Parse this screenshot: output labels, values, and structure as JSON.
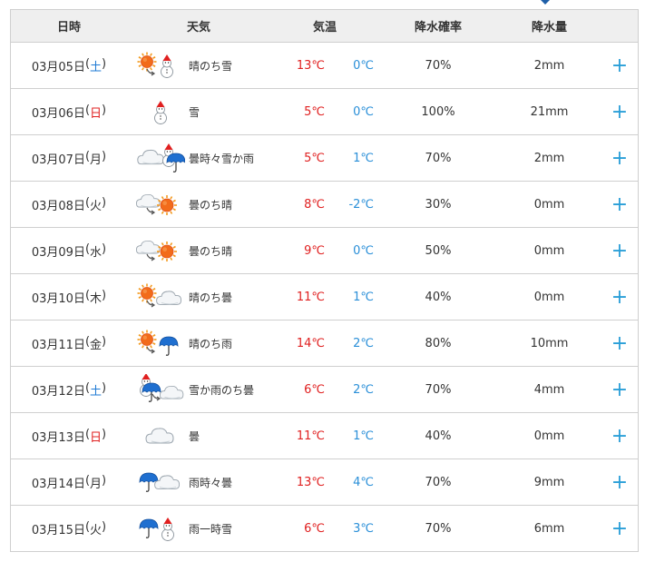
{
  "header": {
    "date": "日時",
    "weather": "天気",
    "temp": "気温",
    "precip_prob": "降水確率",
    "precip_amount": "降水量"
  },
  "colors": {
    "max_temp": "#e02020",
    "min_temp": "#2a8fd8",
    "saturday": "#1e7ad4",
    "sunday": "#e02020",
    "expand": "#2a9fd8"
  },
  "rows": [
    {
      "date": "03月05日",
      "dow": "土",
      "dow_type": "sat",
      "icon": "sun-then-snow-icon",
      "weather": "晴のち雪",
      "max": "13℃",
      "min": "0℃",
      "prob": "70%",
      "amount": "2mm",
      "expand": "+"
    },
    {
      "date": "03月06日",
      "dow": "日",
      "dow_type": "sun",
      "icon": "snow-icon",
      "weather": "雪",
      "max": "5℃",
      "min": "0℃",
      "prob": "100%",
      "amount": "21mm",
      "expand": "+"
    },
    {
      "date": "03月07日",
      "dow": "月",
      "dow_type": "week",
      "icon": "cloud-sometimes-snow-or-rain-icon",
      "weather": "曇時々雪か雨",
      "max": "5℃",
      "min": "1℃",
      "prob": "70%",
      "amount": "2mm",
      "expand": "+"
    },
    {
      "date": "03月08日",
      "dow": "火",
      "dow_type": "week",
      "icon": "cloud-then-sun-icon",
      "weather": "曇のち晴",
      "max": "8℃",
      "min": "-2℃",
      "prob": "30%",
      "amount": "0mm",
      "expand": "+"
    },
    {
      "date": "03月09日",
      "dow": "水",
      "dow_type": "week",
      "icon": "cloud-then-sun-icon",
      "weather": "曇のち晴",
      "max": "9℃",
      "min": "0℃",
      "prob": "50%",
      "amount": "0mm",
      "expand": "+"
    },
    {
      "date": "03月10日",
      "dow": "木",
      "dow_type": "week",
      "icon": "sun-then-cloud-icon",
      "weather": "晴のち曇",
      "max": "11℃",
      "min": "1℃",
      "prob": "40%",
      "amount": "0mm",
      "expand": "+"
    },
    {
      "date": "03月11日",
      "dow": "金",
      "dow_type": "week",
      "icon": "sun-then-rain-icon",
      "weather": "晴のち雨",
      "max": "14℃",
      "min": "2℃",
      "prob": "80%",
      "amount": "10mm",
      "expand": "+"
    },
    {
      "date": "03月12日",
      "dow": "土",
      "dow_type": "sat",
      "icon": "snow-or-rain-then-cloud-icon",
      "weather": "雪か雨のち曇",
      "max": "6℃",
      "min": "2℃",
      "prob": "70%",
      "amount": "4mm",
      "expand": "+"
    },
    {
      "date": "03月13日",
      "dow": "日",
      "dow_type": "sun",
      "icon": "cloud-icon",
      "weather": "曇",
      "max": "11℃",
      "min": "1℃",
      "prob": "40%",
      "amount": "0mm",
      "expand": "+"
    },
    {
      "date": "03月14日",
      "dow": "月",
      "dow_type": "week",
      "icon": "rain-sometimes-cloud-icon",
      "weather": "雨時々曇",
      "max": "13℃",
      "min": "4℃",
      "prob": "70%",
      "amount": "9mm",
      "expand": "+"
    },
    {
      "date": "03月15日",
      "dow": "火",
      "dow_type": "week",
      "icon": "rain-briefly-snow-icon",
      "weather": "雨一時雪",
      "max": "6℃",
      "min": "3℃",
      "prob": "70%",
      "amount": "6mm",
      "expand": "+"
    }
  ]
}
